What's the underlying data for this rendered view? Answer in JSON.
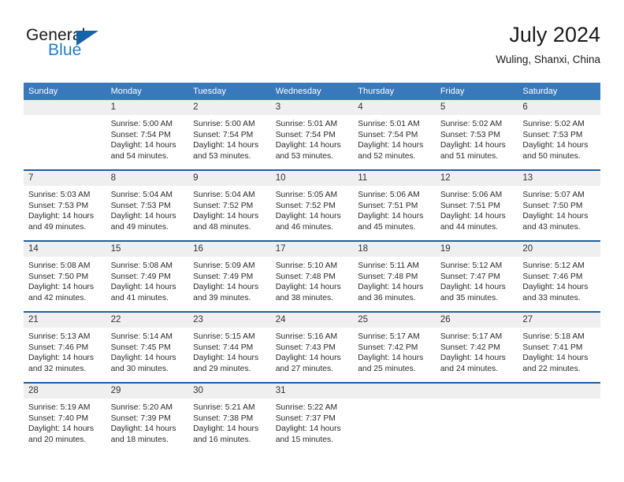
{
  "brand": {
    "name_part1": "General",
    "name_part2": "Blue",
    "triangle_color": "#1464aa",
    "blue_color": "#1f7fd0"
  },
  "header": {
    "title": "July 2024",
    "subtitle": "Wuling, Shanxi, China"
  },
  "theme": {
    "header_row_bg": "#3879bc",
    "week_separator": "#1a5fa4",
    "daynum_band_bg": "#efefef",
    "text_color": "#2b2b2b"
  },
  "weekday_headers": [
    "Sunday",
    "Monday",
    "Tuesday",
    "Wednesday",
    "Thursday",
    "Friday",
    "Saturday"
  ],
  "labels": {
    "sunrise_prefix": "Sunrise:",
    "sunset_prefix": "Sunset:",
    "daylight_prefix": "Daylight:"
  },
  "weeks": [
    [
      {
        "day": "",
        "sunrise": "",
        "sunset": "",
        "daylight_line1": "",
        "daylight_line2": ""
      },
      {
        "day": "1",
        "sunrise": "Sunrise: 5:00 AM",
        "sunset": "Sunset: 7:54 PM",
        "daylight_line1": "Daylight: 14 hours",
        "daylight_line2": "and 54 minutes."
      },
      {
        "day": "2",
        "sunrise": "Sunrise: 5:00 AM",
        "sunset": "Sunset: 7:54 PM",
        "daylight_line1": "Daylight: 14 hours",
        "daylight_line2": "and 53 minutes."
      },
      {
        "day": "3",
        "sunrise": "Sunrise: 5:01 AM",
        "sunset": "Sunset: 7:54 PM",
        "daylight_line1": "Daylight: 14 hours",
        "daylight_line2": "and 53 minutes."
      },
      {
        "day": "4",
        "sunrise": "Sunrise: 5:01 AM",
        "sunset": "Sunset: 7:54 PM",
        "daylight_line1": "Daylight: 14 hours",
        "daylight_line2": "and 52 minutes."
      },
      {
        "day": "5",
        "sunrise": "Sunrise: 5:02 AM",
        "sunset": "Sunset: 7:53 PM",
        "daylight_line1": "Daylight: 14 hours",
        "daylight_line2": "and 51 minutes."
      },
      {
        "day": "6",
        "sunrise": "Sunrise: 5:02 AM",
        "sunset": "Sunset: 7:53 PM",
        "daylight_line1": "Daylight: 14 hours",
        "daylight_line2": "and 50 minutes."
      }
    ],
    [
      {
        "day": "7",
        "sunrise": "Sunrise: 5:03 AM",
        "sunset": "Sunset: 7:53 PM",
        "daylight_line1": "Daylight: 14 hours",
        "daylight_line2": "and 49 minutes."
      },
      {
        "day": "8",
        "sunrise": "Sunrise: 5:04 AM",
        "sunset": "Sunset: 7:53 PM",
        "daylight_line1": "Daylight: 14 hours",
        "daylight_line2": "and 49 minutes."
      },
      {
        "day": "9",
        "sunrise": "Sunrise: 5:04 AM",
        "sunset": "Sunset: 7:52 PM",
        "daylight_line1": "Daylight: 14 hours",
        "daylight_line2": "and 48 minutes."
      },
      {
        "day": "10",
        "sunrise": "Sunrise: 5:05 AM",
        "sunset": "Sunset: 7:52 PM",
        "daylight_line1": "Daylight: 14 hours",
        "daylight_line2": "and 46 minutes."
      },
      {
        "day": "11",
        "sunrise": "Sunrise: 5:06 AM",
        "sunset": "Sunset: 7:51 PM",
        "daylight_line1": "Daylight: 14 hours",
        "daylight_line2": "and 45 minutes."
      },
      {
        "day": "12",
        "sunrise": "Sunrise: 5:06 AM",
        "sunset": "Sunset: 7:51 PM",
        "daylight_line1": "Daylight: 14 hours",
        "daylight_line2": "and 44 minutes."
      },
      {
        "day": "13",
        "sunrise": "Sunrise: 5:07 AM",
        "sunset": "Sunset: 7:50 PM",
        "daylight_line1": "Daylight: 14 hours",
        "daylight_line2": "and 43 minutes."
      }
    ],
    [
      {
        "day": "14",
        "sunrise": "Sunrise: 5:08 AM",
        "sunset": "Sunset: 7:50 PM",
        "daylight_line1": "Daylight: 14 hours",
        "daylight_line2": "and 42 minutes."
      },
      {
        "day": "15",
        "sunrise": "Sunrise: 5:08 AM",
        "sunset": "Sunset: 7:49 PM",
        "daylight_line1": "Daylight: 14 hours",
        "daylight_line2": "and 41 minutes."
      },
      {
        "day": "16",
        "sunrise": "Sunrise: 5:09 AM",
        "sunset": "Sunset: 7:49 PM",
        "daylight_line1": "Daylight: 14 hours",
        "daylight_line2": "and 39 minutes."
      },
      {
        "day": "17",
        "sunrise": "Sunrise: 5:10 AM",
        "sunset": "Sunset: 7:48 PM",
        "daylight_line1": "Daylight: 14 hours",
        "daylight_line2": "and 38 minutes."
      },
      {
        "day": "18",
        "sunrise": "Sunrise: 5:11 AM",
        "sunset": "Sunset: 7:48 PM",
        "daylight_line1": "Daylight: 14 hours",
        "daylight_line2": "and 36 minutes."
      },
      {
        "day": "19",
        "sunrise": "Sunrise: 5:12 AM",
        "sunset": "Sunset: 7:47 PM",
        "daylight_line1": "Daylight: 14 hours",
        "daylight_line2": "and 35 minutes."
      },
      {
        "day": "20",
        "sunrise": "Sunrise: 5:12 AM",
        "sunset": "Sunset: 7:46 PM",
        "daylight_line1": "Daylight: 14 hours",
        "daylight_line2": "and 33 minutes."
      }
    ],
    [
      {
        "day": "21",
        "sunrise": "Sunrise: 5:13 AM",
        "sunset": "Sunset: 7:46 PM",
        "daylight_line1": "Daylight: 14 hours",
        "daylight_line2": "and 32 minutes."
      },
      {
        "day": "22",
        "sunrise": "Sunrise: 5:14 AM",
        "sunset": "Sunset: 7:45 PM",
        "daylight_line1": "Daylight: 14 hours",
        "daylight_line2": "and 30 minutes."
      },
      {
        "day": "23",
        "sunrise": "Sunrise: 5:15 AM",
        "sunset": "Sunset: 7:44 PM",
        "daylight_line1": "Daylight: 14 hours",
        "daylight_line2": "and 29 minutes."
      },
      {
        "day": "24",
        "sunrise": "Sunrise: 5:16 AM",
        "sunset": "Sunset: 7:43 PM",
        "daylight_line1": "Daylight: 14 hours",
        "daylight_line2": "and 27 minutes."
      },
      {
        "day": "25",
        "sunrise": "Sunrise: 5:17 AM",
        "sunset": "Sunset: 7:42 PM",
        "daylight_line1": "Daylight: 14 hours",
        "daylight_line2": "and 25 minutes."
      },
      {
        "day": "26",
        "sunrise": "Sunrise: 5:17 AM",
        "sunset": "Sunset: 7:42 PM",
        "daylight_line1": "Daylight: 14 hours",
        "daylight_line2": "and 24 minutes."
      },
      {
        "day": "27",
        "sunrise": "Sunrise: 5:18 AM",
        "sunset": "Sunset: 7:41 PM",
        "daylight_line1": "Daylight: 14 hours",
        "daylight_line2": "and 22 minutes."
      }
    ],
    [
      {
        "day": "28",
        "sunrise": "Sunrise: 5:19 AM",
        "sunset": "Sunset: 7:40 PM",
        "daylight_line1": "Daylight: 14 hours",
        "daylight_line2": "and 20 minutes."
      },
      {
        "day": "29",
        "sunrise": "Sunrise: 5:20 AM",
        "sunset": "Sunset: 7:39 PM",
        "daylight_line1": "Daylight: 14 hours",
        "daylight_line2": "and 18 minutes."
      },
      {
        "day": "30",
        "sunrise": "Sunrise: 5:21 AM",
        "sunset": "Sunset: 7:38 PM",
        "daylight_line1": "Daylight: 14 hours",
        "daylight_line2": "and 16 minutes."
      },
      {
        "day": "31",
        "sunrise": "Sunrise: 5:22 AM",
        "sunset": "Sunset: 7:37 PM",
        "daylight_line1": "Daylight: 14 hours",
        "daylight_line2": "and 15 minutes."
      },
      {
        "day": "",
        "sunrise": "",
        "sunset": "",
        "daylight_line1": "",
        "daylight_line2": ""
      },
      {
        "day": "",
        "sunrise": "",
        "sunset": "",
        "daylight_line1": "",
        "daylight_line2": ""
      },
      {
        "day": "",
        "sunrise": "",
        "sunset": "",
        "daylight_line1": "",
        "daylight_line2": ""
      }
    ]
  ]
}
